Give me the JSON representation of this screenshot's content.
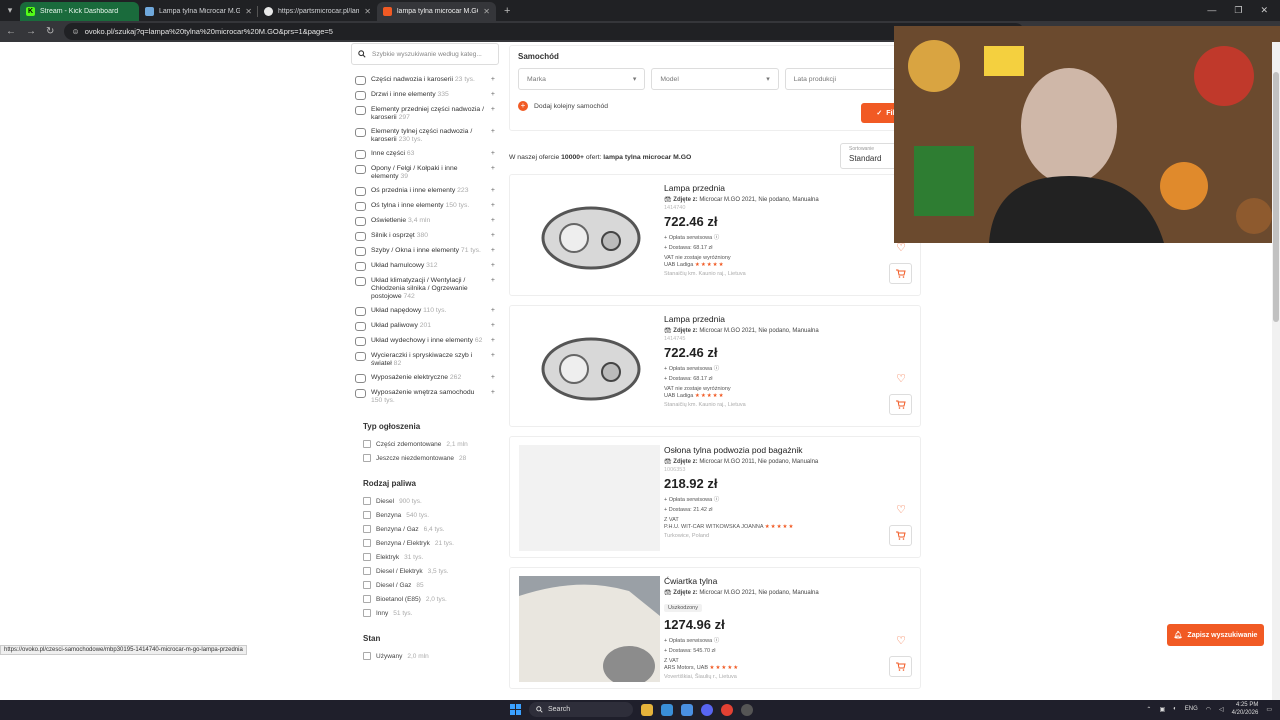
{
  "browser": {
    "tabs": [
      {
        "title": "Stream - Kick Dashboard",
        "color": "#53fc18"
      },
      {
        "title": "Lampa tylna Microcar M.Go - cz",
        "color": "#6fa8dc"
      },
      {
        "title": "https://partsmicrocar.pl/lampy",
        "color": "#e8e8e8"
      },
      {
        "title": "lampa tylna microcar M.GO - sz",
        "color": "#f15a24"
      }
    ],
    "new_tab": "+",
    "url": "ovoko.pl/szukaj?q=lampa%20tylna%20microcar%20M.GO&prs=1&page=5"
  },
  "sidebar": {
    "search_placeholder": "Szybkie wyszukiwanie według kateg...",
    "categories": [
      {
        "name": "Części nadwozia i karoserii",
        "count": "23 tys."
      },
      {
        "name": "Drzwi i inne elementy",
        "count": "335"
      },
      {
        "name": "Elementy przedniej części nadwozia / karoserii",
        "count": "297"
      },
      {
        "name": "Elementy tylnej części nadwozia / karoserii",
        "count": "230 tys."
      },
      {
        "name": "Inne części",
        "count": "63"
      },
      {
        "name": "Opony / Felgi / Kołpaki i inne elementy",
        "count": "39"
      },
      {
        "name": "Oś przednia i inne elementy",
        "count": "223"
      },
      {
        "name": "Oś tylna i inne elementy",
        "count": "150 tys."
      },
      {
        "name": "Oświetlenie",
        "count": "3,4 mln"
      },
      {
        "name": "Silnik i osprzęt",
        "count": "380"
      },
      {
        "name": "Szyby / Okna i inne elementy",
        "count": "71 tys."
      },
      {
        "name": "Układ hamulcowy",
        "count": "312"
      },
      {
        "name": "Układ klimatyzacji / Wentylacji / Chłodzenia silnika / Ogrzewanie postojowe",
        "count": "742"
      },
      {
        "name": "Układ napędowy",
        "count": "110 tys."
      },
      {
        "name": "Układ paliwowy",
        "count": "201"
      },
      {
        "name": "Układ wydechowy i inne elementy",
        "count": "62"
      },
      {
        "name": "Wycieraczki i spryskiwacze szyb i świateł",
        "count": "82"
      },
      {
        "name": "Wyposażenie elektryczne",
        "count": "262"
      },
      {
        "name": "Wyposażenie wnętrza samochodu",
        "count": "150 tys."
      }
    ],
    "typ_heading": "Typ ogłoszenia",
    "typ_options": [
      {
        "label": "Części zdemontowane",
        "count": "2,1 mln"
      },
      {
        "label": "Jeszcze niezdemontowane",
        "count": "28"
      }
    ],
    "fuel_heading": "Rodzaj paliwa",
    "fuel_options": [
      {
        "label": "Diesel",
        "count": "900 tys."
      },
      {
        "label": "Benzyna",
        "count": "540 tys."
      },
      {
        "label": "Benzyna / Gaz",
        "count": "6,4 tys."
      },
      {
        "label": "Benzyna / Elektryk",
        "count": "21 tys."
      },
      {
        "label": "Elektryk",
        "count": "31 tys."
      },
      {
        "label": "Diesel / Elektryk",
        "count": "3,5 tys."
      },
      {
        "label": "Diesel / Gaz",
        "count": "85"
      },
      {
        "label": "Bioetanol (E85)",
        "count": "2,0 tys."
      },
      {
        "label": "Inny",
        "count": "51 tys."
      }
    ],
    "stan_heading": "Stan",
    "stan_options": [
      {
        "label": "Używany",
        "count": "2,0 mln"
      }
    ]
  },
  "car_filter": {
    "heading": "Samochód",
    "make": "Marka",
    "model": "Model",
    "year": "Lata produkcji",
    "add_car": "Dodaj kolejny samochód",
    "filter_button": "Filtruj"
  },
  "results": {
    "summary_prefix": "W naszej ofercie",
    "summary_count": "10000+",
    "summary_mid": "ofert:",
    "query": "lampa tylna microcar M.GO",
    "sort_label": "Sortowanie",
    "sort_value": "Standard"
  },
  "listings": [
    {
      "title": "Lampa przednia",
      "fits_label": "Zdjęte z:",
      "fits": "Microcar M.GO 2021, Nie podano, Manualna",
      "ref": "1414740",
      "condition": "",
      "price": "722.46 zł",
      "fee": "Opłata serwisowa",
      "delivery": "Dostawa: 68.17 zł",
      "vat": "VAT nie zostaje wyróżniony",
      "seller": "UAB Ladiga",
      "stars": "★★★★★",
      "location": "Stanaičių km. Kaunio raj., Lietuva"
    },
    {
      "title": "Lampa przednia",
      "fits_label": "Zdjęte z:",
      "fits": "Microcar M.GO 2021, Nie podano, Manualna",
      "ref": "1414745",
      "condition": "",
      "price": "722.46 zł",
      "fee": "Opłata serwisowa",
      "delivery": "Dostawa: 68.17 zł",
      "vat": "VAT nie zostaje wyróżniony",
      "seller": "UAB Ladiga",
      "stars": "★★★★★",
      "location": "Stanaičių km. Kaunio raj., Lietuva"
    },
    {
      "title": "Osłona tylna podwozia pod bagażnik",
      "fits_label": "Zdjęte z:",
      "fits": "Microcar M.GO 2011, Nie podano, Manualna",
      "ref": "1006353",
      "condition": "",
      "price": "218.92 zł",
      "fee": "Opłata serwisowa",
      "delivery": "Dostawa: 21.42 zł",
      "vat": "Z VAT",
      "seller": "P.H.U. WIT-CAR WITKOWSKA JOANNA",
      "stars": "★★★★★",
      "location": "Turkowice, Poland"
    },
    {
      "title": "Ćwiartka tylna",
      "fits_label": "Zdjęte z:",
      "fits": "Microcar M.GO 2021, Nie podano, Manualna",
      "ref": "",
      "condition": "Uszkodzony",
      "price": "1274.96 zł",
      "fee": "Opłata serwisowa",
      "delivery": "Dostawa: 545.70 zł",
      "vat": "Z VAT",
      "seller": "ARS Motors, UAB",
      "stars": "★★★★★",
      "location": "Vovertiškiai, Šiaulių r., Lietuva"
    }
  ],
  "save_search": "Zapisz wyszukiwanie",
  "status_url": "https://ovoko.pl/czesci-samochodowe/mbp30195-1414740-microcar-m-go-lampa-przednia",
  "taskbar": {
    "search": "Search",
    "lang": "ENG",
    "time": "4:25 PM",
    "date": "4/20/2026"
  },
  "colors": {
    "accent": "#f15a24",
    "kick_tab": "#1a6b3c"
  }
}
